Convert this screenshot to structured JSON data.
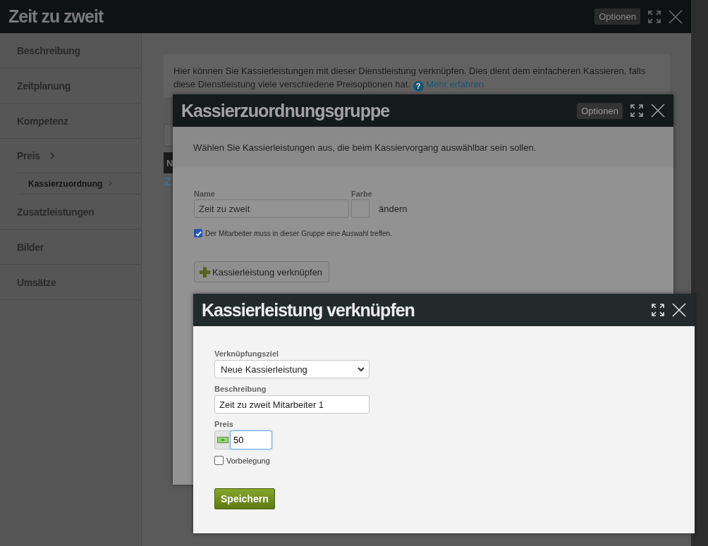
{
  "window": {
    "title": "Zeit zu zweit",
    "options_button": "Optionen"
  },
  "sidebar": {
    "items": [
      {
        "label": "Beschreibung",
        "selected": false
      },
      {
        "label": "Zeitplanung",
        "selected": false
      },
      {
        "label": "Kompetenz",
        "selected": false
      },
      {
        "label": "Preis",
        "selected": false,
        "children": [
          {
            "label": "Kassierzuordnung",
            "selected": true
          }
        ]
      },
      {
        "label": "Zusatzleistungen",
        "selected": false
      },
      {
        "label": "Bilder",
        "selected": false
      },
      {
        "label": "Umsätze",
        "selected": false
      }
    ]
  },
  "content": {
    "info_text": "Hier können Sie Kassierleistungen mit dieser Dienstleistung verknüpfen. Dies dient dem einfacheren Kassieren, falls diese Dienstleistung viele verschiedene Preisoptionen hat.",
    "help_icon": "?",
    "help_link": "Mehr erfahren",
    "table_header_cell": "N",
    "table_link": "Z"
  },
  "group_dialog": {
    "title": "Kassierzuordnungsgruppe",
    "options_button": "Optionen",
    "description": "Wählen Sie Kassierleistungen aus, die beim Kassiervorgang auswählbar sein sollen.",
    "name_label": "Name",
    "name_value": "Zeit zu zweit",
    "color_label": "Farbe",
    "color_change": "ändern",
    "required_checkbox": {
      "label": "Der Mitarbeiter muss in dieser Gruppe eine Auswahl treffen.",
      "checked": true
    },
    "link_button": "Kassierleistung verknüpfen"
  },
  "link_dialog": {
    "title": "Kassierleistung verknüpfen",
    "target_label": "Verknüpfungsziel",
    "target_value": "Neue Kassierleistung",
    "description_label": "Beschreibung",
    "description_value": "Zeit zu zweit Mitarbeiter 1",
    "price_label": "Preis",
    "price_value": "50",
    "preset_checkbox": {
      "label": "Vorbelegung",
      "checked": false
    },
    "save_button": "Speichern"
  }
}
